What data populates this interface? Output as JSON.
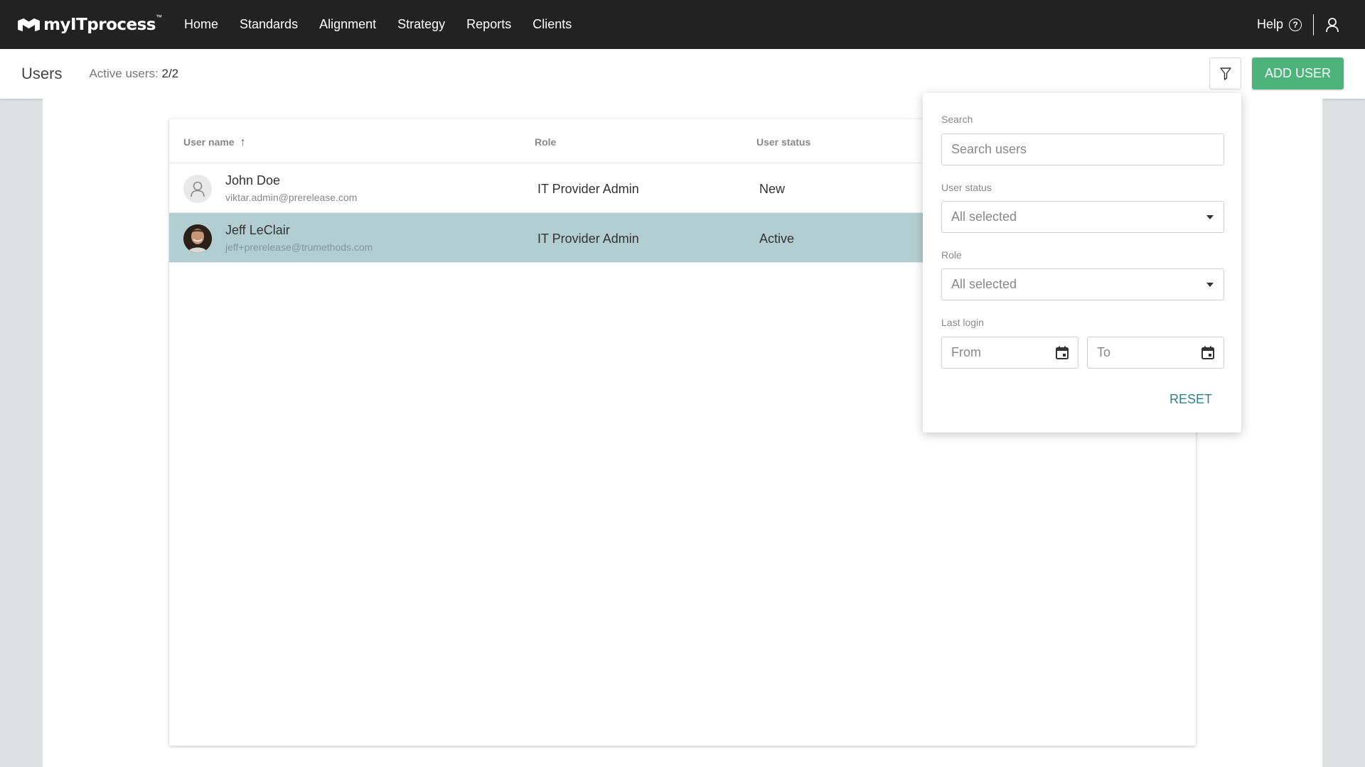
{
  "app": {
    "brand": "myITprocess",
    "brand_tm": "™"
  },
  "nav": {
    "items": [
      "Home",
      "Standards",
      "Alignment",
      "Strategy",
      "Reports",
      "Clients"
    ],
    "help_label": "Help"
  },
  "subheader": {
    "title": "Users",
    "active_label": "Active users:",
    "active_value": "2/2",
    "add_user_label": "ADD USER"
  },
  "table": {
    "columns": [
      "User name",
      "Role",
      "User status"
    ],
    "sort_indicator": "↑",
    "rows": [
      {
        "name": "John Doe",
        "email": "viktar.admin@prerelease.com",
        "role": "IT Provider Admin",
        "status": "New",
        "avatar": "placeholder-user-icon",
        "selected": false
      },
      {
        "name": "Jeff LeClair",
        "email": "jeff+prerelease@trumethods.com",
        "role": "IT Provider Admin",
        "status": "Active",
        "avatar": "photo",
        "selected": true
      }
    ]
  },
  "filter": {
    "search_label": "Search",
    "search_placeholder": "Search users",
    "status_label": "User status",
    "status_value": "All selected",
    "role_label": "Role",
    "role_value": "All selected",
    "last_login_label": "Last login",
    "from_placeholder": "From",
    "to_placeholder": "To",
    "reset_label": "RESET"
  },
  "colors": {
    "topbar": "#222222",
    "accent_green": "#4cb47b",
    "selected_row": "#b3ced1",
    "link_teal": "#2f8088"
  }
}
